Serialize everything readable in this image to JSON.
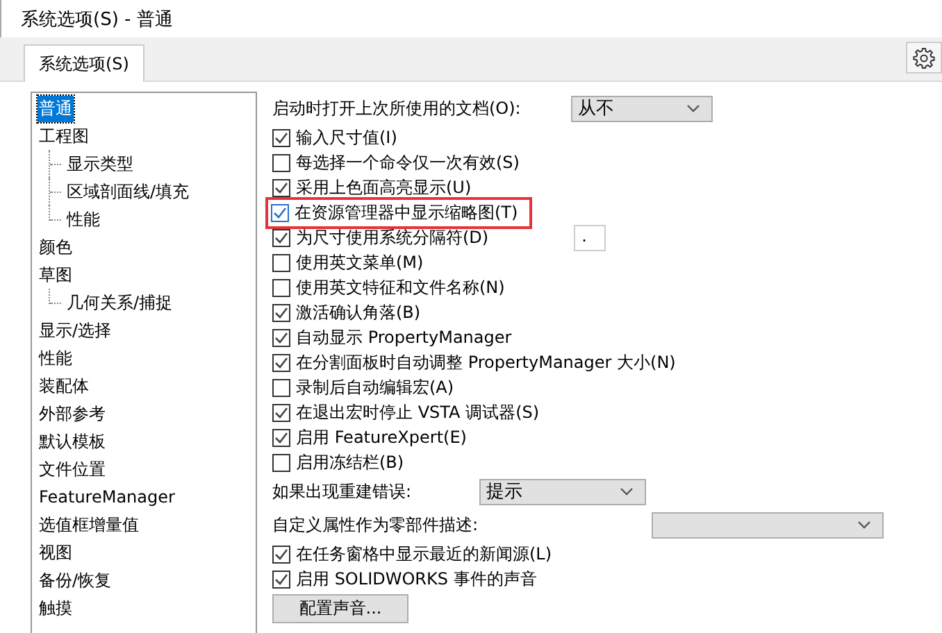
{
  "window": {
    "title": "系统选项(S) - 普通"
  },
  "tabs": [
    {
      "label": "系统选项(S)",
      "selected": true
    }
  ],
  "tree": [
    {
      "label": "普通",
      "selected": true
    },
    {
      "label": "工程图",
      "selected": false,
      "children": [
        {
          "label": "显示类型",
          "selected": false
        },
        {
          "label": "区域剖面线/填充",
          "selected": false
        },
        {
          "label": "性能",
          "selected": false
        }
      ]
    },
    {
      "label": "颜色",
      "selected": false
    },
    {
      "label": "草图",
      "selected": false,
      "children": [
        {
          "label": "几何关系/捕捉",
          "selected": false
        }
      ]
    },
    {
      "label": "显示/选择",
      "selected": false
    },
    {
      "label": "性能",
      "selected": false
    },
    {
      "label": "装配体",
      "selected": false
    },
    {
      "label": "外部参考",
      "selected": false
    },
    {
      "label": "默认模板",
      "selected": false
    },
    {
      "label": "文件位置",
      "selected": false
    },
    {
      "label": "FeatureManager",
      "selected": false
    },
    {
      "label": "选值框增量值",
      "selected": false
    },
    {
      "label": "视图",
      "selected": false
    },
    {
      "label": "备份/恢复",
      "selected": false
    },
    {
      "label": "触摸",
      "selected": false
    }
  ],
  "options": [
    {
      "kind": "dropdown",
      "label": "启动时打开上次所使用的文档(O):",
      "value": "从不"
    },
    {
      "kind": "checkbox",
      "label": "输入尺寸值(I)",
      "checked": true
    },
    {
      "kind": "checkbox",
      "label": "每选择一个命令仅一次有效(S)",
      "checked": false
    },
    {
      "kind": "checkbox",
      "label": "采用上色面高亮显示(U)",
      "checked": true
    },
    {
      "kind": "checkbox",
      "label": "在资源管理器中显示缩略图(T)",
      "checked": true,
      "highlighted": true
    },
    {
      "kind": "checkbox",
      "label": "为尺寸使用系统分隔符(D)",
      "checked": true,
      "field_value": "."
    },
    {
      "kind": "checkbox",
      "label": "使用英文菜单(M)",
      "checked": false
    },
    {
      "kind": "checkbox",
      "label": "使用英文特征和文件名称(N)",
      "checked": false
    },
    {
      "kind": "checkbox",
      "label": "激活确认角落(B)",
      "checked": true
    },
    {
      "kind": "checkbox",
      "label": "自动显示 PropertyManager",
      "checked": true
    },
    {
      "kind": "checkbox",
      "label": "在分割面板时自动调整 PropertyManager 大小(N)",
      "checked": true
    },
    {
      "kind": "checkbox",
      "label": "录制后自动编辑宏(A)",
      "checked": false
    },
    {
      "kind": "checkbox",
      "label": "在退出宏时停止 VSTA 调试器(S)",
      "checked": true
    },
    {
      "kind": "checkbox",
      "label": "启用 FeatureXpert(E)",
      "checked": true
    },
    {
      "kind": "checkbox",
      "label": "启用冻结栏(B)",
      "checked": false
    },
    {
      "kind": "dropdown",
      "label": "如果出现重建错误:",
      "value": "提示"
    },
    {
      "kind": "dropdown",
      "label": "自定义属性作为零部件描述:"
    },
    {
      "kind": "checkbox",
      "label": "在任务窗格中显示最近的新闻源(L)",
      "checked": true
    },
    {
      "kind": "checkbox",
      "label": "启用 SOLIDWORKS 事件的声音",
      "checked": true
    },
    {
      "kind": "button",
      "label": "配置声音..."
    }
  ]
}
